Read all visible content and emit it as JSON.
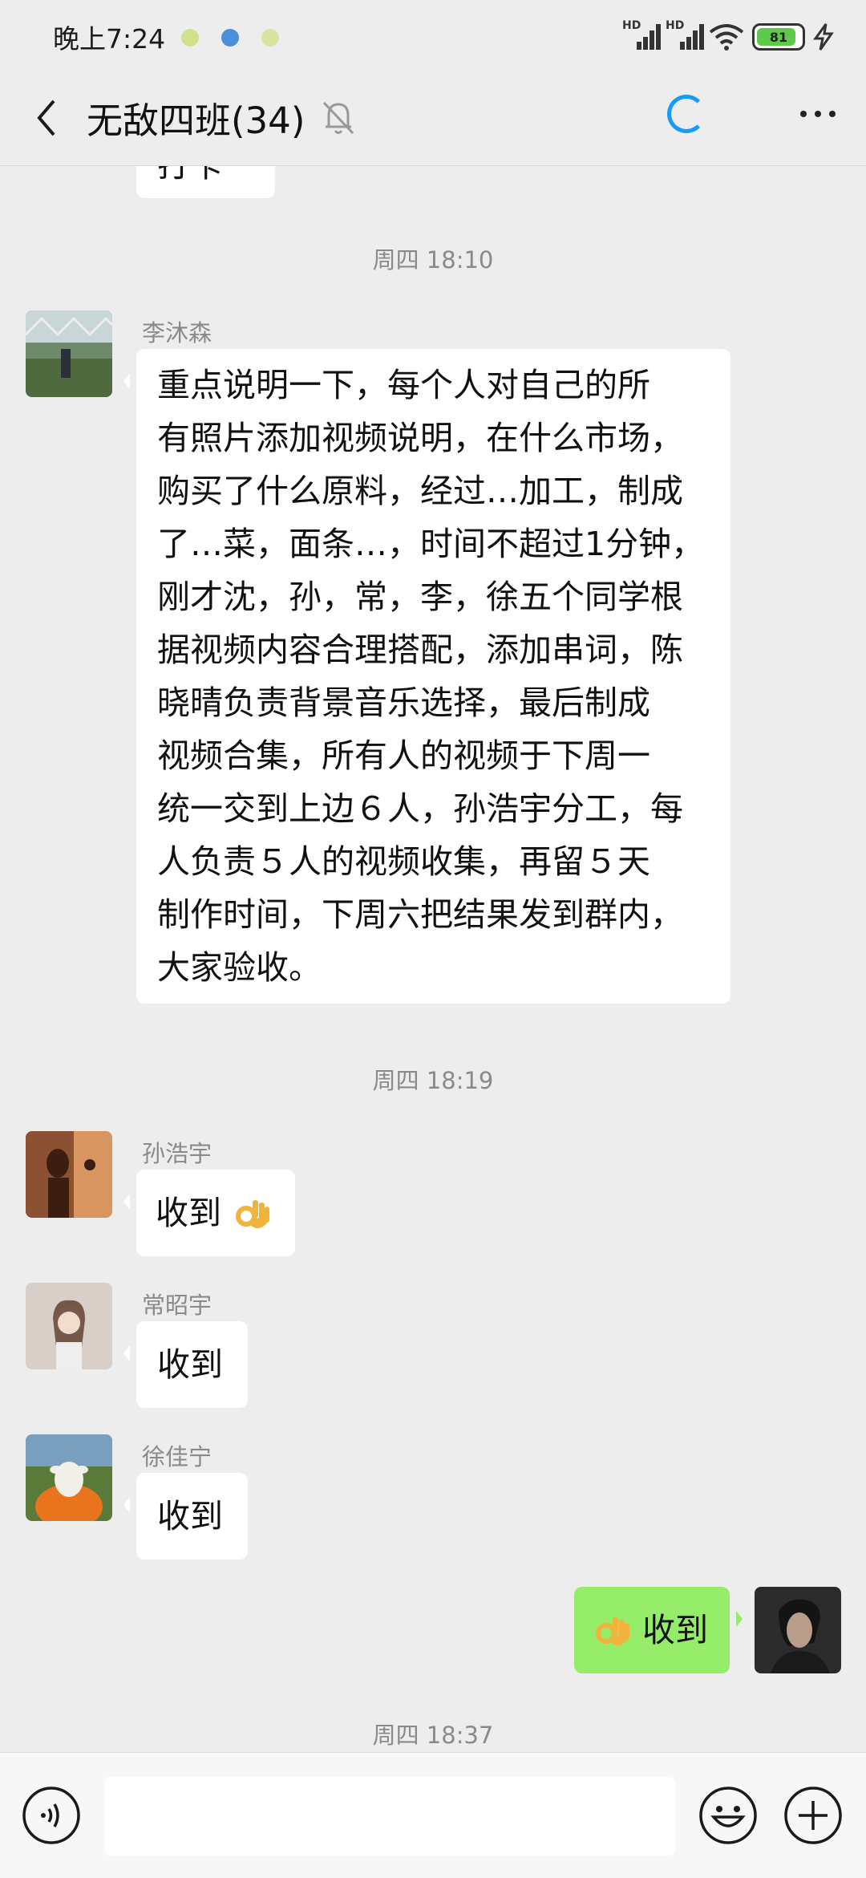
{
  "status_bar": {
    "time": "晚上7:24",
    "signal_1_label": "HD",
    "signal_2_label": "HD",
    "battery": "81"
  },
  "header": {
    "title": "无敌四班(34)",
    "icons": [
      "back-icon",
      "mute-bell-icon",
      "loading-icon",
      "more-icon"
    ]
  },
  "chat": {
    "partial_message": "打卡了",
    "time_1": "周四 18:10",
    "msg_1": {
      "sender": "李沐森",
      "lines": [
        "重点说明一下，每个人对自己的所",
        "有照片添加视频说明，在什么市场，",
        "购买了什么原料，经过…加工，制成",
        "了…菜，面条…，时间不超过1分钟，",
        "刚才沈，孙，常，李，徐五个同学根",
        "据视频内容合理搭配，添加串词，陈",
        "晓晴负责背景音乐选择，最后制成",
        "视频合集，所有人的视频于下周一",
        "统一交到上边６人，孙浩宇分工，每",
        "人负责５人的视频收集，再留５天",
        "制作时间，下周六把结果发到群内，",
        "大家验收。"
      ]
    },
    "time_2": "周四 18:19",
    "msg_2": {
      "sender": "孙浩宇",
      "text": "收到"
    },
    "msg_3": {
      "sender": "常昭宇",
      "text": "收到"
    },
    "msg_4": {
      "sender": "徐佳宁",
      "text": "收到"
    },
    "msg_5": {
      "text": "收到"
    },
    "time_3": "周四 18:37"
  },
  "input_bar": {
    "placeholder": "",
    "icons": [
      "voice-icon",
      "emoji-icon",
      "plus-icon"
    ]
  },
  "colors": {
    "background": "#ededed",
    "my_bubble": "#95ec69",
    "other_bubble": "#ffffff",
    "accent": "#1a9af7"
  }
}
